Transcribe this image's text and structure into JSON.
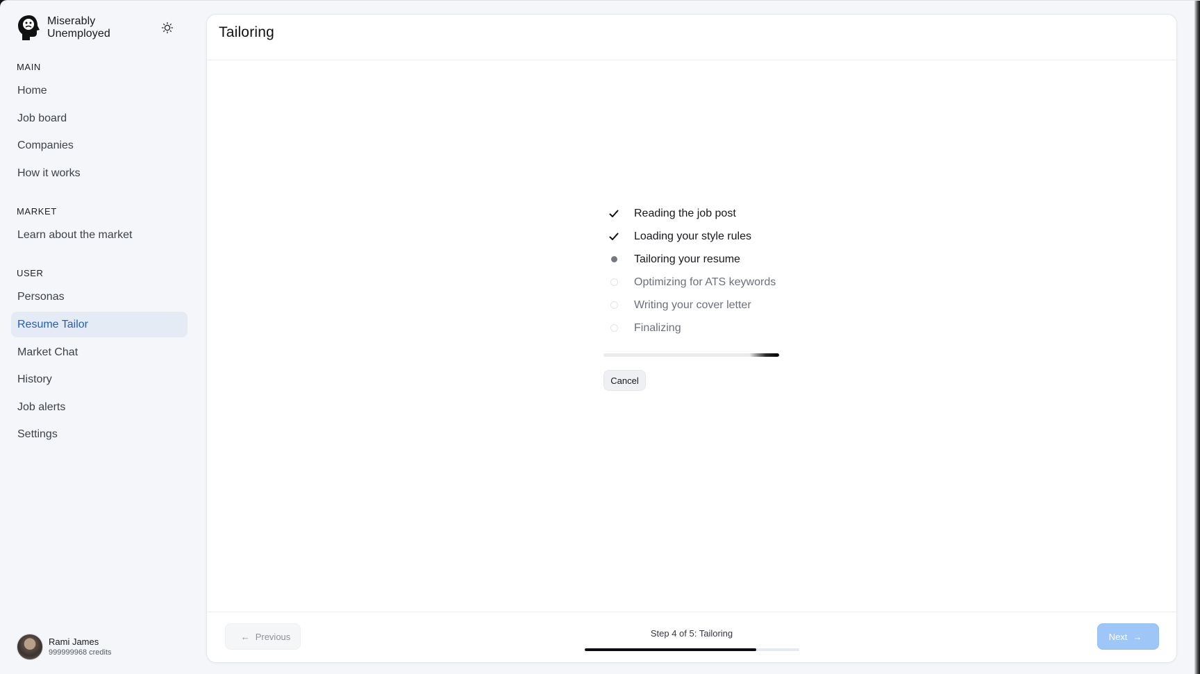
{
  "brand": {
    "name": "Miserably Unemployed"
  },
  "sidebar": {
    "sections": [
      {
        "title": "MAIN",
        "items": [
          "Home",
          "Job board",
          "Companies",
          "How it works"
        ]
      },
      {
        "title": "MARKET",
        "items": [
          "Learn about the market"
        ]
      },
      {
        "title": "USER",
        "items": [
          "Personas",
          "Resume Tailor",
          "Market Chat",
          "History",
          "Job alerts",
          "Settings"
        ]
      }
    ],
    "active_item": "Resume Tailor"
  },
  "user": {
    "name": "Rami James",
    "credits": "999999968 credits"
  },
  "page": {
    "title": "Tailoring"
  },
  "progress_steps": [
    {
      "label": "Reading the job post",
      "status": "done"
    },
    {
      "label": "Loading your style rules",
      "status": "done"
    },
    {
      "label": "Tailoring your resume",
      "status": "current"
    },
    {
      "label": "Optimizing for ATS keywords",
      "status": "pending"
    },
    {
      "label": "Writing your cover letter",
      "status": "pending"
    },
    {
      "label": "Finalizing",
      "status": "pending"
    }
  ],
  "tailoring_progress": 0.17,
  "cancel_label": "Cancel",
  "footer": {
    "previous_label": "Previous",
    "step_text": "Step 4 of 5: Tailoring",
    "next_label": "Next",
    "wizard_progress": 0.8
  },
  "colors": {
    "accent": "#1f5fbf",
    "active_bg": "#e5ebf5",
    "next_button": "#9ec6f7"
  }
}
